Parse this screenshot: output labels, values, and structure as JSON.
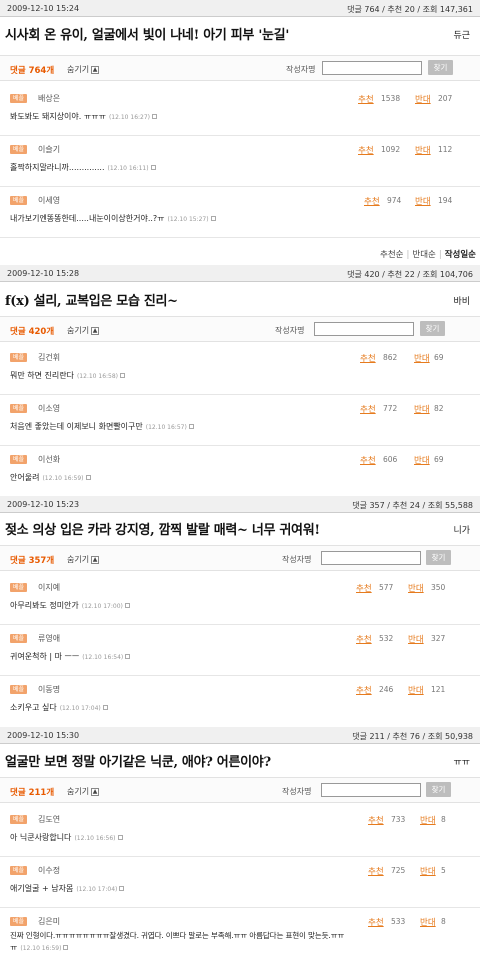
{
  "posts": [
    {
      "date": "2009-12-10 15:24",
      "stats": "댓글 764 / 추천 20 / 조회 147,361",
      "title": "시사회 온 유이, 얼굴에서 빛이 나네! 아기 피부 '눈길'",
      "source": "듀근",
      "count_label": "댓글 764개",
      "hide_label": "숨기기",
      "author_label": "작성자명",
      "search_label": "찾기",
      "comments": [
        {
          "badge": "베플",
          "name": "배상은",
          "text": "봐도봐도 돼지상이야. ㅠㅠㅠ",
          "time": "(12.10 16:27)",
          "up": "추천",
          "up_n": "1538",
          "down": "반대",
          "down_n": "207"
        },
        {
          "badge": "베플",
          "name": "이슬기",
          "text": "홀짝하지말라니까..............",
          "time": "(12.10 16:11)",
          "up": "추천",
          "up_n": "1092",
          "down": "반대",
          "down_n": "112"
        },
        {
          "badge": "베플",
          "name": "이세영",
          "text": "내가보기엔똥똥한데.....내눈이이상한거야..?ㅠ",
          "time": "(12.10 15:27)",
          "up": "추천",
          "up_n": "974",
          "down": "반대",
          "down_n": "194"
        }
      ],
      "sort": [
        "추천순",
        "반대순",
        "작성일순"
      ]
    },
    {
      "date": "2009-12-10 15:28",
      "stats": "댓글 420 / 추천 22 / 조회 104,706",
      "title": "f(x) 설리, 교복입은 모습 진리~",
      "source": "바비",
      "count_label": "댓글 420개",
      "hide_label": "숨기기",
      "author_label": "작성자명",
      "search_label": "찾기",
      "comments": [
        {
          "badge": "베플",
          "name": "김건휘",
          "text": "뭐만 하면 진리란다",
          "time": "(12.10 16:58)",
          "up": "추천",
          "up_n": "862",
          "down": "반대",
          "down_n": "69"
        },
        {
          "badge": "베플",
          "name": "이소영",
          "text": "처음엔 좋았는데 이제보니 화면빨이구만",
          "time": "(12.10 16:57)",
          "up": "추천",
          "up_n": "772",
          "down": "반대",
          "down_n": "82"
        },
        {
          "badge": "베플",
          "name": "이선화",
          "text": "안어울려",
          "time": "(12.10 16:59)",
          "up": "추천",
          "up_n": "606",
          "down": "반대",
          "down_n": "69"
        }
      ]
    },
    {
      "date": "2009-12-10 15:23",
      "stats": "댓글 357 / 추천 24 / 조회 55,588",
      "title": "젖소 의상 입은 카라 강지영, 깜찍 발랄 매력~ 너무 귀여워!",
      "source": "니가",
      "count_label": "댓글 357개",
      "hide_label": "숨기기",
      "author_label": "작성자명",
      "search_label": "찾기",
      "comments": [
        {
          "badge": "베플",
          "name": "이지예",
          "text": "아무리봐도 정미안가",
          "time": "(12.10 17:00)",
          "up": "추천",
          "up_n": "577",
          "down": "반대",
          "down_n": "350"
        },
        {
          "badge": "베플",
          "name": "류영애",
          "text": "귀여운척하 | 마 ㅡㅡ",
          "time": "(12.10 16:54)",
          "up": "추천",
          "up_n": "532",
          "down": "반대",
          "down_n": "327"
        },
        {
          "badge": "베플",
          "name": "이동명",
          "text": "소키우고 싶다",
          "time": "(12.10 17:04)",
          "up": "추천",
          "up_n": "246",
          "down": "반대",
          "down_n": "121"
        }
      ]
    },
    {
      "date": "2009-12-10 15:30",
      "stats": "댓글 211 / 추천 76 / 조회 50,938",
      "title": "얼굴만 보면 정말 아기같은 닉쿤, 애야? 어른이야?",
      "source": "ㅠㅠ",
      "count_label": "댓글 211개",
      "hide_label": "숨기기",
      "author_label": "작성자명",
      "search_label": "찾기",
      "comments": [
        {
          "badge": "베플",
          "name": "김도연",
          "text": "아 닉쿤사랑합니다",
          "time": "(12.10 16:56)",
          "up": "추천",
          "up_n": "733",
          "down": "반대",
          "down_n": "8"
        },
        {
          "badge": "베플",
          "name": "이수정",
          "text": "애기얼굴 + 남자몸",
          "time": "(12.10 17:04)",
          "up": "추천",
          "up_n": "725",
          "down": "반대",
          "down_n": "5"
        },
        {
          "badge": "베플",
          "name": "김은미",
          "text": "진짜 인형이다.ㅠㅠㅠㅠㅠㅠㅠㅠ잘생겼다. 귀엽다. 이쁘다 말로는 부족해.ㅠㅠ 아름답다는 표현이 맞는듯.ㅠㅠ",
          "text2": "ㅠ",
          "time": "(12.10 16:59)",
          "up": "추천",
          "up_n": "533",
          "down": "반대",
          "down_n": "8"
        }
      ]
    }
  ]
}
